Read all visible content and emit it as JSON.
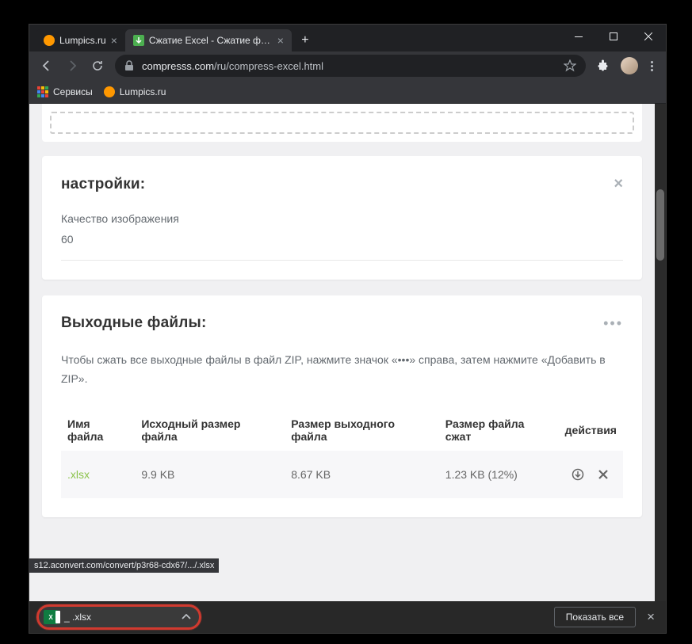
{
  "tabs": [
    {
      "title": "Lumpics.ru",
      "active": false
    },
    {
      "title": "Сжатие Excel - Сжатие файлов X",
      "active": true
    }
  ],
  "address": {
    "domain": "compresss.com",
    "path": "/ru/compress-excel.html"
  },
  "bookmarks": {
    "services": "Сервисы",
    "lumpics": "Lumpics.ru"
  },
  "settings": {
    "title": "настройки:",
    "quality_label": "Качество изображения",
    "quality_value": "60"
  },
  "output": {
    "title": "Выходные файлы:",
    "description": "Чтобы сжать все выходные файлы в файл ZIP, нажмите значок «•••» справа, затем нажмите «Добавить в ZIP».",
    "columns": {
      "name": "Имя файла",
      "original": "Исходный размер файла",
      "output": "Размер выходного файла",
      "compressed": "Размер файла сжат",
      "actions": "действия"
    },
    "rows": [
      {
        "name": ".xlsx",
        "original": "9.9 KB",
        "output": "8.67 KB",
        "compressed": "1.23 KB (12%)"
      }
    ]
  },
  "tooltip": "s12.aconvert.com/convert/p3r68-cdx67/.../.xlsx",
  "downloads": {
    "file": "_ .xlsx",
    "show_all": "Показать все"
  }
}
